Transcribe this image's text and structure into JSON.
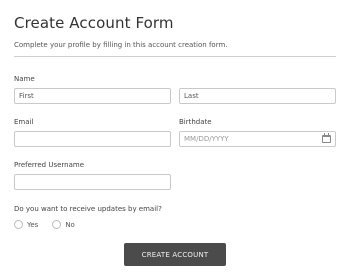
{
  "form": {
    "title": "Create Account Form",
    "subtitle": "Complete your profile by filling in this account creation form."
  },
  "name": {
    "label": "Name",
    "first_placeholder": "First",
    "last_placeholder": "Last"
  },
  "email": {
    "label": "Email",
    "value": ""
  },
  "birthdate": {
    "label": "Birthdate",
    "placeholder": "MM/DD/YYYY",
    "icon": "calendar-icon"
  },
  "username": {
    "label": "Preferred Username",
    "value": ""
  },
  "updates": {
    "question": "Do you want to receive updates by email?",
    "options": [
      "Yes",
      "No"
    ]
  },
  "submit": {
    "label": "CREATE ACCOUNT"
  }
}
